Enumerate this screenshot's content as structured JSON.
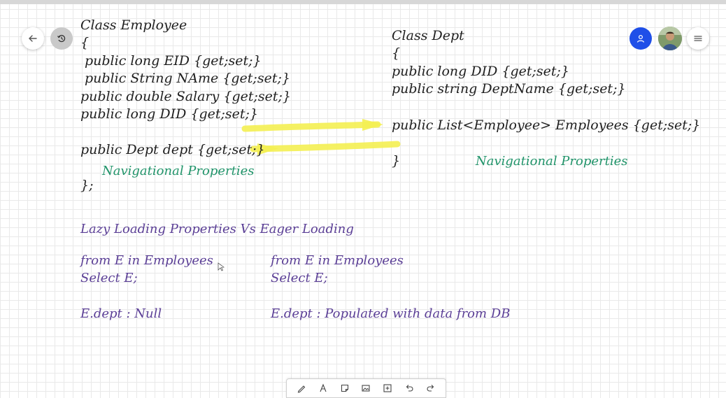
{
  "employee_class": {
    "title": "Class Employee",
    "open_brace": "{",
    "line_eid": "public long EID {get;set;}",
    "line_name": "public String NAme {get;set;}",
    "line_salary": "public double Salary {get;set;}",
    "line_did": "public long DID {get;set;}",
    "line_dept": "public Dept dept {get;set;}",
    "nav_note": "Navigational Properties",
    "close_brace": "};"
  },
  "dept_class": {
    "title": "Class Dept",
    "open_brace": "{",
    "line_did": "public long DID {get;set;}",
    "line_deptname": "public string DeptName {get;set;}",
    "line_employees": "public List<Employee> Employees {get;set;}",
    "close_brace": "}",
    "nav_note": "Navigational Properties"
  },
  "loading": {
    "heading": "Lazy Loading Properties Vs Eager Loading",
    "lazy": {
      "query_line1": "from E in Employees",
      "query_line2": "Select E;",
      "result": "E.dept : Null"
    },
    "eager": {
      "query_line1": "from E in Employees",
      "query_line2": "Select E;",
      "result": "E.dept : Populated with data from DB"
    }
  },
  "colors": {
    "code_ink": "#1f1f1f",
    "nav_ink": "#21946a",
    "loading_ink": "#5b3f96",
    "highlighter": "#f4ef52",
    "profile_button": "#1f4fe8"
  },
  "icons": {
    "back": "arrow-left-icon",
    "undo_history": "history-icon",
    "profile": "person-icon",
    "menu": "hamburger-icon",
    "tools": [
      "pen-icon",
      "text-icon",
      "sticky-note-icon",
      "image-icon",
      "add-box-icon",
      "undo-icon",
      "redo-icon"
    ]
  }
}
